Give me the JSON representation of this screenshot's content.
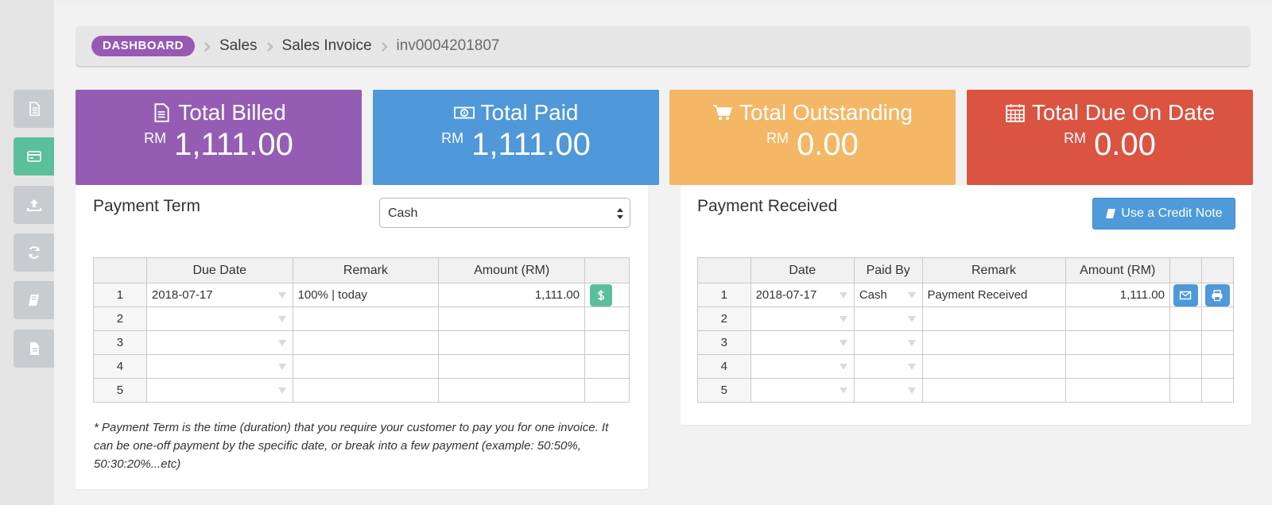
{
  "sidebar": {
    "tabs": [
      {
        "icon": "file-icon",
        "active": false
      },
      {
        "icon": "credit-card-icon",
        "active": true
      },
      {
        "icon": "upload-icon",
        "active": false
      },
      {
        "icon": "refresh-icon",
        "active": false
      },
      {
        "icon": "book-icon",
        "active": false
      },
      {
        "icon": "document-icon",
        "active": false
      }
    ]
  },
  "breadcrumb": {
    "home": "DASHBOARD",
    "items": [
      "Sales",
      "Sales Invoice"
    ],
    "current": "inv0004201807"
  },
  "stats": [
    {
      "title": "Total Billed",
      "currency": "RM",
      "amount": "1,111.00",
      "color": "#945db3",
      "icon": "file-icon"
    },
    {
      "title": "Total Paid",
      "currency": "RM",
      "amount": "1,111.00",
      "color": "#4f98d9",
      "icon": "money-icon"
    },
    {
      "title": "Total Outstanding",
      "currency": "RM",
      "amount": "0.00",
      "color": "#f4b766",
      "icon": "cart-icon"
    },
    {
      "title": "Total Due On Date",
      "currency": "RM",
      "amount": "0.00",
      "color": "#da5441",
      "icon": "calendar-icon"
    }
  ],
  "payment_term": {
    "title": "Payment Term",
    "select_value": "Cash",
    "columns": [
      "",
      "Due Date",
      "Remark",
      "Amount (RM)",
      ""
    ],
    "rows": [
      {
        "n": "1",
        "due_date": "2018-07-17",
        "remark": "100% |  today",
        "amount": "1,111.00"
      },
      {
        "n": "2",
        "due_date": "",
        "remark": "",
        "amount": ""
      },
      {
        "n": "3",
        "due_date": "",
        "remark": "",
        "amount": ""
      },
      {
        "n": "4",
        "due_date": "",
        "remark": "",
        "amount": ""
      },
      {
        "n": "5",
        "due_date": "",
        "remark": "",
        "amount": ""
      }
    ],
    "note": "* Payment Term is the time (duration) that you require your customer to pay you for one invoice. It can be one-off payment by the specific date, or break into a few payment (example: 50:50%, 50:30:20%...etc)"
  },
  "payment_received": {
    "title": "Payment Received",
    "credit_button": "Use a Credit Note",
    "columns": [
      "",
      "Date",
      "Paid By",
      "Remark",
      "Amount (RM)",
      "",
      ""
    ],
    "rows": [
      {
        "n": "1",
        "date": "2018-07-17",
        "paid_by": "Cash",
        "remark": "Payment Received",
        "amount": "1,111.00"
      },
      {
        "n": "2",
        "date": "",
        "paid_by": "",
        "remark": "",
        "amount": ""
      },
      {
        "n": "3",
        "date": "",
        "paid_by": "",
        "remark": "",
        "amount": ""
      },
      {
        "n": "4",
        "date": "",
        "paid_by": "",
        "remark": "",
        "amount": ""
      },
      {
        "n": "5",
        "date": "",
        "paid_by": "",
        "remark": "",
        "amount": ""
      }
    ]
  },
  "colors": {
    "green_action": "#5cbf9c",
    "blue_action": "#4f98d9"
  }
}
